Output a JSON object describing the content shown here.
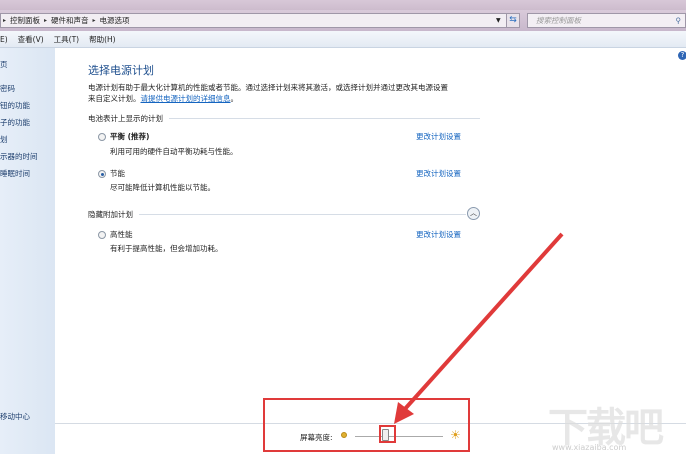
{
  "address": {
    "crumbs": [
      "控制面板",
      "硬件和声音",
      "电源选项"
    ],
    "search_placeholder": "搜索控制面板"
  },
  "menu": [
    "E)",
    "查看(V)",
    "工具(T)",
    "帮助(H)"
  ],
  "sidebar": {
    "items": [
      "页",
      "密码",
      "钮的功能",
      "子的功能",
      "划",
      "示器的时间",
      "睡眠时间"
    ],
    "bottom": "移动中心"
  },
  "main": {
    "title": "选择电源计划",
    "desc_line1": "电源计划有助于最大化计算机的性能或者节能。通过选择计划来将其激活，或选择计划并通过更改其电源设置",
    "desc_line2": "来自定义计划。",
    "desc_link": "请提供电源计划的详细信息",
    "desc_end": "。",
    "group1": "电池表计上显示的计划",
    "group2": "隐藏附加计划",
    "plans": [
      {
        "name": "平衡 (推荐)",
        "desc": "利用可用的硬件自动平衡功耗与性能。",
        "link": "更改计划设置",
        "selected": false
      },
      {
        "name": "节能",
        "desc": "尽可能降低计算机性能以节能。",
        "link": "更改计划设置",
        "selected": true
      },
      {
        "name": "高性能",
        "desc": "有利于提高性能，但会增加功耗。",
        "link": "更改计划设置",
        "selected": false
      }
    ]
  },
  "brightness": {
    "label": "屏幕亮度:",
    "value_percent": 35
  },
  "watermark": {
    "text": "下载吧",
    "url": "www.xiazaiba.com"
  },
  "colors": {
    "accent": "#1565c0",
    "annotation": "#e03a3a"
  }
}
